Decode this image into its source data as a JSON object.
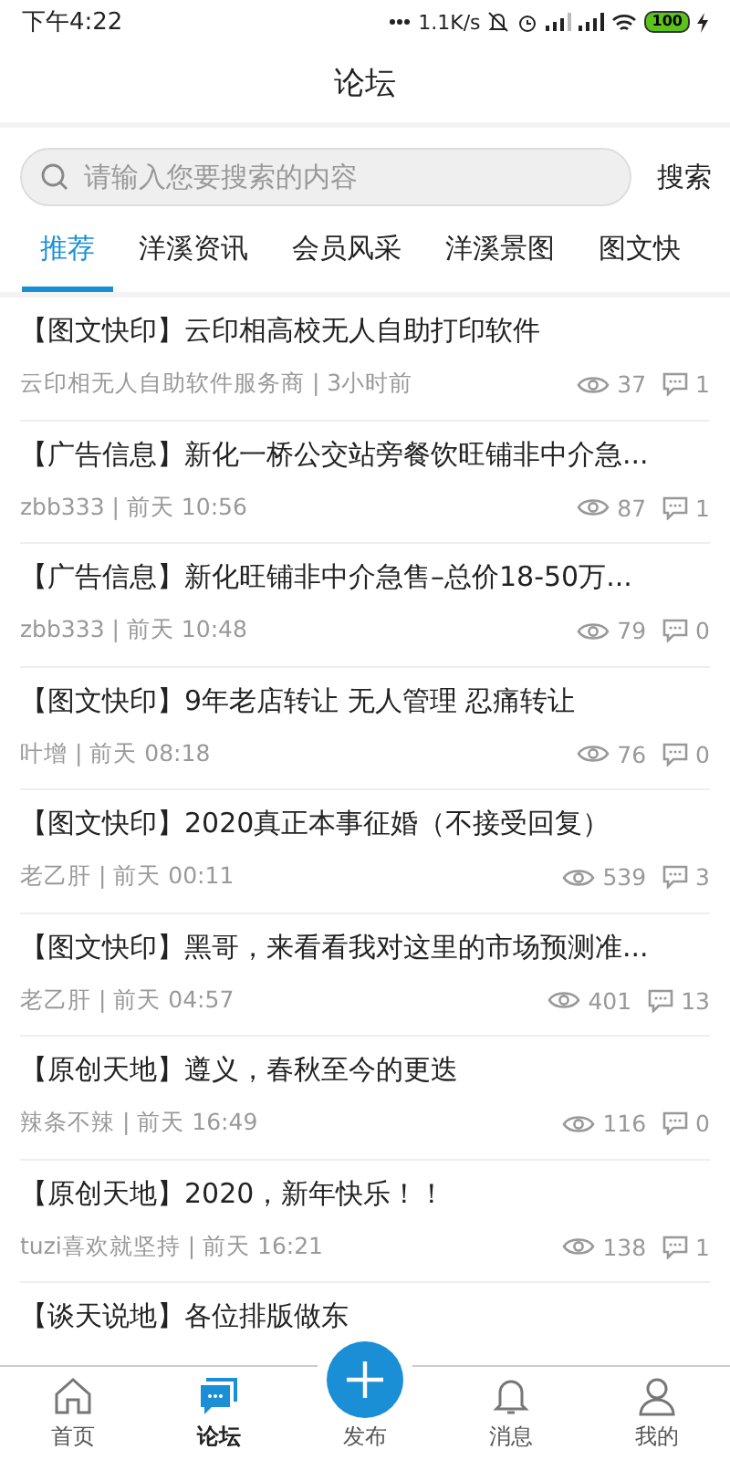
{
  "status_bar": {
    "time": "下午4:22",
    "speed": "1.1K/s",
    "battery": "100"
  },
  "header": {
    "title": "论坛"
  },
  "search": {
    "placeholder": "请输入您要搜索的内容",
    "button": "搜索"
  },
  "tabs": [
    {
      "label": "推荐",
      "selected": true
    },
    {
      "label": "洋溪资讯",
      "selected": false
    },
    {
      "label": "会员风采",
      "selected": false
    },
    {
      "label": "洋溪景图",
      "selected": false
    },
    {
      "label": "图文快",
      "selected": false
    }
  ],
  "posts": [
    {
      "title": "【图文快印】云印相高校无人自助打印软件",
      "meta": "云印相无人自助软件服务商 | 3小时前",
      "views": "37",
      "comments": "1"
    },
    {
      "title": "【广告信息】新化一桥公交站旁餐饮旺铺非中介急...",
      "meta": "zbb333 | 前天 10:56",
      "views": "87",
      "comments": "1"
    },
    {
      "title": "【广告信息】新化旺铺非中介急售–总价18-50万...",
      "meta": "zbb333 | 前天 10:48",
      "views": "79",
      "comments": "0"
    },
    {
      "title": "【图文快印】9年老店转让 无人管理 忍痛转让",
      "meta": "叶增 | 前天 08:18",
      "views": "76",
      "comments": "0"
    },
    {
      "title": "【图文快印】2020真正本事征婚（不接受回复）",
      "meta": "老乙肝 | 前天 00:11",
      "views": "539",
      "comments": "3"
    },
    {
      "title": "【图文快印】黑哥，来看看我对这里的市场预测准...",
      "meta": "老乙肝 | 前天 04:57",
      "views": "401",
      "comments": "13"
    },
    {
      "title": "【原创天地】遵义，春秋至今的更迭",
      "meta": "辣条不辣 | 前天 16:49",
      "views": "116",
      "comments": "0"
    },
    {
      "title": "【原创天地】2020，新年快乐！！",
      "meta": "tuzi喜欢就坚持 | 前天 16:21",
      "views": "138",
      "comments": "1"
    },
    {
      "title": "【谈天说地】各位排版做东"
    }
  ],
  "nav": [
    {
      "kind": "home",
      "label": "首页",
      "selected": false
    },
    {
      "kind": "forum",
      "label": "论坛",
      "selected": true
    },
    {
      "kind": "add",
      "label": "发布",
      "selected": false
    },
    {
      "kind": "bell",
      "label": "消息",
      "selected": false
    },
    {
      "kind": "user",
      "label": "我的",
      "selected": false
    }
  ]
}
